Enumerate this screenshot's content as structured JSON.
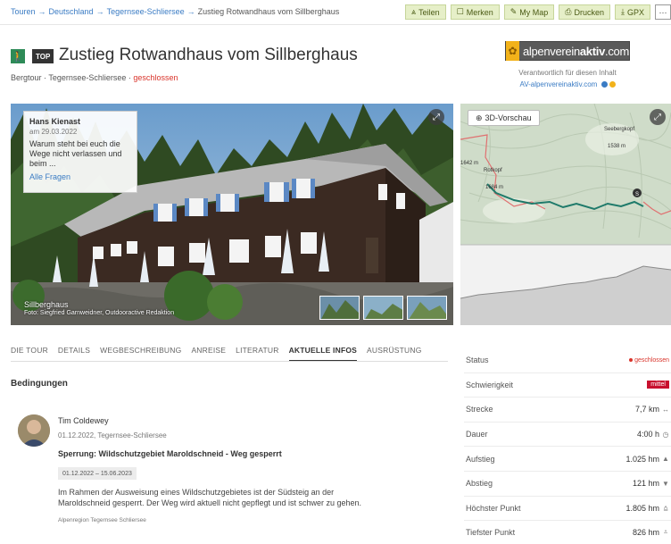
{
  "breadcrumb": {
    "items": [
      "Touren",
      "Deutschland",
      "Tegernsee-Schliersee"
    ],
    "current": "Zustieg Rotwandhaus vom Sillberghaus"
  },
  "actions": [
    {
      "label": "Teilen",
      "icon": "share-icon"
    },
    {
      "label": "Merken",
      "icon": "bookmark-icon"
    },
    {
      "label": "My Map",
      "icon": "map-edit-icon"
    },
    {
      "label": "Drucken",
      "icon": "print-icon"
    },
    {
      "label": "GPX",
      "icon": "download-icon"
    },
    {
      "label": "···",
      "icon": "more-icon"
    }
  ],
  "header": {
    "badge": "TOP",
    "title": "Zustieg Rotwandhaus vom Sillberghaus",
    "category": "Bergtour",
    "region": "Tegernsee-Schliersee",
    "status": "geschlossen"
  },
  "publisher": {
    "logo_text_light": "alpenverein",
    "logo_text_bold": "aktiv",
    "logo_text_suffix": ".com",
    "responsible_label": "Verantwortlich für diesen Inhalt",
    "link": "AV-alpenvereinaktiv.com"
  },
  "photo": {
    "caption_title": "Sillberghaus",
    "caption_credit": "Foto: Siegfried Garnweidner, Outdooractive Redaktion"
  },
  "question": {
    "author": "Hans Kienast",
    "date": "am 29.03.2022",
    "text": "Warum steht bei euch die Wege nicht verlassen und beim ...",
    "link": "Alle Fragen"
  },
  "map": {
    "button_3d": "3D-Vorschau",
    "labels": [
      "Seebergkopf",
      "1538 m",
      "Rotkopf",
      "1684 m",
      "1642 m"
    ]
  },
  "tabs": [
    {
      "label": "DIE TOUR",
      "active": false
    },
    {
      "label": "DETAILS",
      "active": false
    },
    {
      "label": "WEGBESCHREIBUNG",
      "active": false
    },
    {
      "label": "ANREISE",
      "active": false
    },
    {
      "label": "LITERATUR",
      "active": false
    },
    {
      "label": "AKTUELLE INFOS",
      "active": true
    },
    {
      "label": "AUSRÜSTUNG",
      "active": false
    }
  ],
  "section_title": "Bedingungen",
  "post": {
    "author": "Tim Coldewey",
    "meta": "01.12.2022, Tegernsee-Schliersee",
    "title": "Sperrung: Wildschutzgebiet Maroldschneid - Weg gesperrt",
    "date_range": "01.12.2022 – 15.06.2023",
    "body": "Im Rahmen der Ausweisung eines Wildschutzgebietes ist der Südsteig an der Maroldschneid gesperrt. Der Weg wird aktuell nicht gepflegt und ist schwer zu gehen.",
    "source": "Alpenregion Tegernsee Schliersee"
  },
  "stats": [
    {
      "label": "Status",
      "value": "geschlossen",
      "type": "closed"
    },
    {
      "label": "Schwierigkeit",
      "value": "mittel",
      "type": "difficulty"
    },
    {
      "label": "Strecke",
      "value": "7,7 km",
      "icon": "↔"
    },
    {
      "label": "Dauer",
      "value": "4:00 h",
      "icon": "◷"
    },
    {
      "label": "Aufstieg",
      "value": "1.025 hm",
      "icon": "▲"
    },
    {
      "label": "Abstieg",
      "value": "121 hm",
      "icon": "▼"
    },
    {
      "label": "Höchster Punkt",
      "value": "1.805 hm",
      "icon": "⩠"
    },
    {
      "label": "Tiefster Punkt",
      "value": "826 hm",
      "icon": "⩡"
    }
  ],
  "colors": {
    "link": "#3b7cc4",
    "closed": "#d9342b",
    "difficulty_medium": "#c8102e",
    "action_bg": "#e6efc8",
    "route": "#1e7a6a"
  }
}
